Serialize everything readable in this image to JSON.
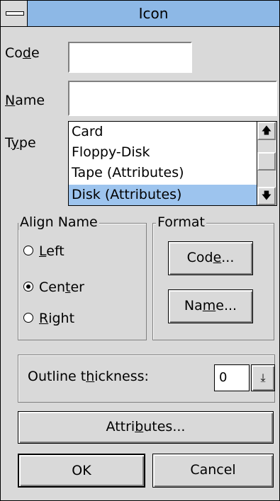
{
  "window": {
    "title": "Icon"
  },
  "code": {
    "label_pre": "Co",
    "label_u": "d",
    "label_post": "e",
    "value": ""
  },
  "name": {
    "label_pre": "",
    "label_u": "N",
    "label_post": "ame",
    "value": ""
  },
  "type": {
    "label_pre": "T",
    "label_u": "y",
    "label_post": "pe",
    "items": [
      "Card",
      "Floppy-Disk",
      "Tape (Attributes)",
      "Disk (Attributes)"
    ],
    "selected": "Disk (Attributes)"
  },
  "align_name": {
    "title": "Align Name",
    "options": [
      {
        "pre": "",
        "u": "L",
        "post": "eft",
        "checked": false
      },
      {
        "pre": "Cen",
        "u": "t",
        "post": "er",
        "checked": true
      },
      {
        "pre": "",
        "u": "R",
        "post": "ight",
        "checked": false
      }
    ]
  },
  "format": {
    "title": "Format",
    "code_button": {
      "pre": "Cod",
      "u": "e",
      "post": "..."
    },
    "name_button": {
      "pre": "Na",
      "u": "m",
      "post": "e..."
    }
  },
  "outline": {
    "pre": "Outline t",
    "u": "h",
    "post": "ickness:",
    "value": "0"
  },
  "attributes_button": {
    "pre": "Attri",
    "u": "b",
    "post": "utes..."
  },
  "ok_label": "OK",
  "cancel_label": "Cancel",
  "colors": {
    "titlebar": "#8db8e6",
    "selection": "#9dc4ee",
    "face": "#d9d9d9"
  }
}
